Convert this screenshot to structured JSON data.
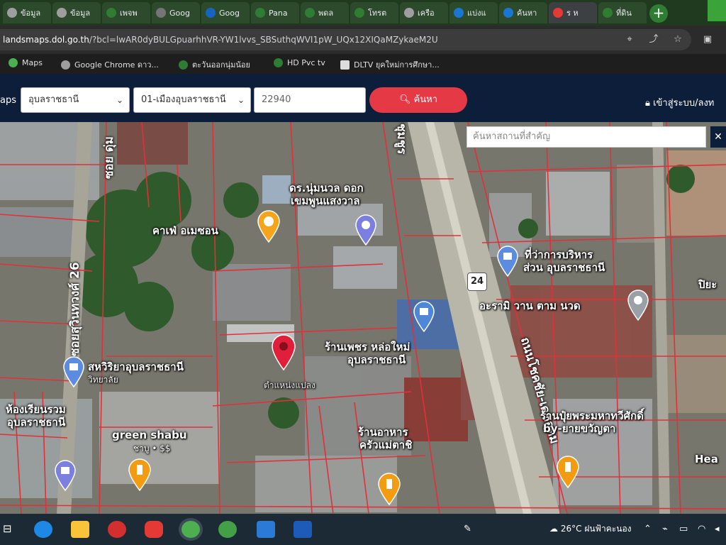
{
  "browser": {
    "tabs": [
      {
        "label": "ข้อมูล",
        "color": "#9e9e9e"
      },
      {
        "label": "ข้อมูล",
        "color": "#9e9e9e"
      },
      {
        "label": "เพจพ",
        "color": "#2e7d32"
      },
      {
        "label": "Goog",
        "color": "#757575"
      },
      {
        "label": "Goog",
        "color": "#1565c0"
      },
      {
        "label": "Pana",
        "color": "#2e7d32"
      },
      {
        "label": "พดล",
        "color": "#2e7d32"
      },
      {
        "label": "โทรต",
        "color": "#2e7d32"
      },
      {
        "label": "เครือ",
        "color": "#9e9e9e"
      },
      {
        "label": "แบ่งแ",
        "color": "#1976d2"
      },
      {
        "label": "ค้นหา",
        "color": "#1976d2"
      },
      {
        "label": "ร ห",
        "color": "#e53935"
      },
      {
        "label": "ที่ดิน",
        "color": "#2e7d32"
      }
    ],
    "new_tab_symbol": "+",
    "url_domain": "landsmaps.dol.go.th",
    "url_path": "/?bcl=lwAR0dyBULGpuarhhVR-YW1lvvs_SBSuthqWVI1pW_UQx12XIQaMZykaeM2U",
    "bookmarks": [
      "Maps",
      "Google Chrome ดาว...",
      "ตะวันออกนุ่มน้อย",
      "HD Pvc tv",
      "DLTV ยุคใหม่การศึกษา..."
    ]
  },
  "site": {
    "brand": "aps",
    "province": "อุบลราชธานี",
    "district": "01-เมืองอุบลราชธานี",
    "parcel_no": "22940",
    "search_label": "ค้นหา",
    "login_label": "เข้าสู่ระบบ/ลงท"
  },
  "map": {
    "search_placeholder": "ค้นหาสถานที่สำคัญ",
    "route_number": "24",
    "roads": {
      "main": "ถนนโชคชัย-เดชอุดม",
      "main_top": "ชุมชูร",
      "soi26": "ซอยสุวินทวงศ์ 26",
      "soi_left": "ซอย ดุ่ม"
    },
    "places": [
      {
        "name": "คาเฟ่ อเมซอน",
        "sub": ""
      },
      {
        "name": "ดร.นุ่มนวล ดอก",
        "sub": "เขมพูนแสงวาล"
      },
      {
        "name": "ที่ว่าการบริหาร",
        "sub": "ส่วน อุบลราชธานี"
      },
      {
        "name": "อะรามิ วาน ตาม นวด",
        "sub": ""
      },
      {
        "name": "ร้านเพชร หล่อใหม่",
        "sub": "อุบลราชธานี"
      },
      {
        "name": "สหวิริยาอุบลราชธานี",
        "sub": "วิทยาลัย"
      },
      {
        "name": "ห้องเรียนรวม",
        "sub": "อุบลราชธานี"
      },
      {
        "name": "green shabu",
        "sub": "ชาบู • $$"
      },
      {
        "name": "ร้านอาหาร",
        "sub": "ครัวแม่ตาชิ"
      },
      {
        "name": "ร้านปุ๋ยพระมหาทวีศักดิ์",
        "sub": "by-ยายขวัญตา"
      },
      {
        "name": "ปิยะ",
        "sub": ""
      },
      {
        "name": "Hea",
        "sub": ""
      }
    ],
    "selected_parcel_text": "ตำแหน่งแปลง"
  },
  "taskbar": {
    "temperature": "26°C",
    "weather": "ฝนฟ้าคะนอง"
  },
  "colors": {
    "header": "#0d1e3a",
    "search_button": "#e53946",
    "parcel_line": "#e0303a",
    "selected_pin": "#e0203a"
  }
}
